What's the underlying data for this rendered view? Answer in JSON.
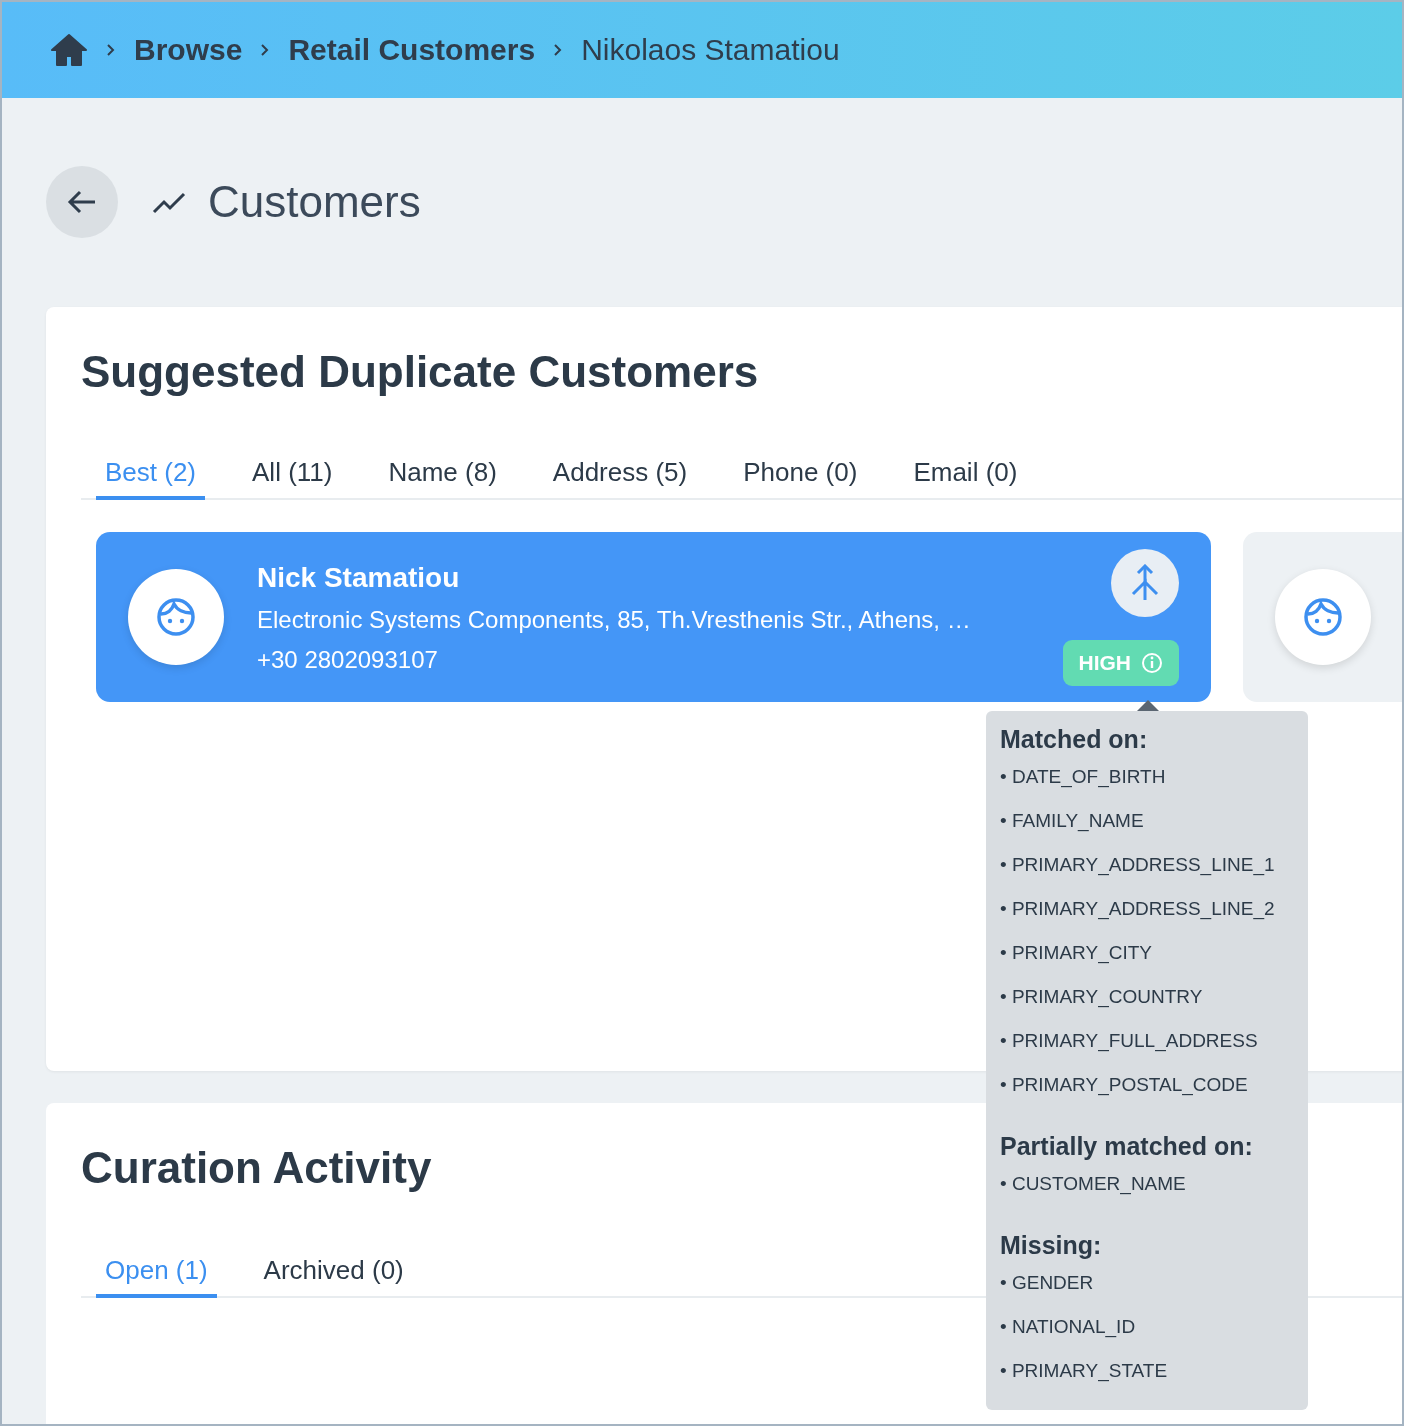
{
  "breadcrumb": [
    {
      "label": "Browse",
      "kind": "link"
    },
    {
      "label": "Retail Customers",
      "kind": "link"
    },
    {
      "label": "Nikolaos Stamatiou",
      "kind": "current"
    }
  ],
  "page_title": "Customers",
  "duplicates": {
    "title": "Suggested Duplicate Customers",
    "tabs": [
      {
        "label": "Best (2)",
        "selected": true
      },
      {
        "label": "All (11)",
        "selected": false
      },
      {
        "label": "Name (8)",
        "selected": false
      },
      {
        "label": "Address (5)",
        "selected": false
      },
      {
        "label": "Phone (0)",
        "selected": false
      },
      {
        "label": "Email (0)",
        "selected": false
      }
    ],
    "customers": [
      {
        "name": "Nick Stamatiou",
        "address": "Electronic Systems Components, 85, Th.Vresthenis Str., Athens, …",
        "phone": "+30 2802093107",
        "confidence": "HIGH",
        "selected": true
      },
      {
        "selected": false
      }
    ]
  },
  "match_tooltip": {
    "sections": [
      {
        "heading": "Matched on:",
        "items": [
          "• DATE_OF_BIRTH",
          "• FAMILY_NAME",
          "• PRIMARY_ADDRESS_LINE_1",
          "• PRIMARY_ADDRESS_LINE_2",
          "• PRIMARY_CITY",
          "• PRIMARY_COUNTRY",
          "• PRIMARY_FULL_ADDRESS",
          "• PRIMARY_POSTAL_CODE"
        ]
      },
      {
        "heading": "Partially matched on:",
        "items": [
          "• CUSTOMER_NAME"
        ]
      },
      {
        "heading": "Missing:",
        "items": [
          "• GENDER",
          "• NATIONAL_ID",
          "• PRIMARY_STATE"
        ]
      }
    ]
  },
  "activity": {
    "title": "Curation Activity",
    "tabs": [
      {
        "label": "Open (1)",
        "selected": true
      },
      {
        "label": "Archived (0)",
        "selected": false
      }
    ]
  }
}
